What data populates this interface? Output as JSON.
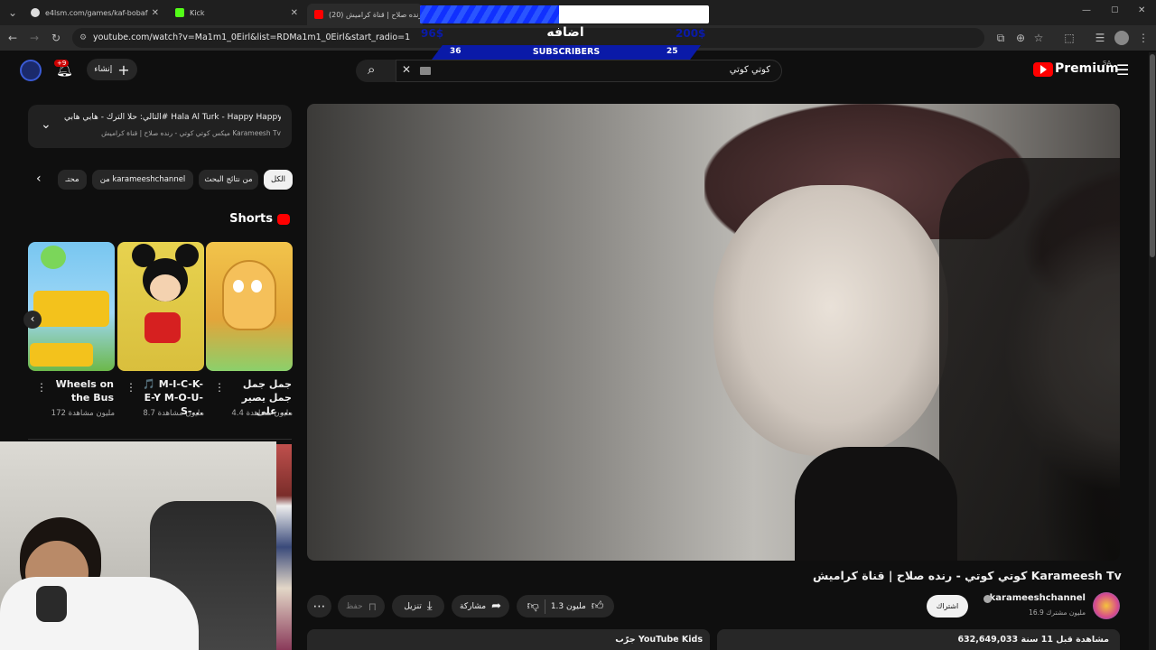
{
  "browser": {
    "tabs": [
      {
        "title": "e4lsm.com/games/kaf-bobaf",
        "active": false
      },
      {
        "title": "Kick",
        "active": false
      },
      {
        "title": "(20) كوتي كوتي - رنده صلاح | قناة كراميش",
        "active": true
      }
    ],
    "url": "youtube.com/watch?v=Ma1m1_0Eirl&list=RDMa1m1_0Eirl&start_radio=1"
  },
  "overlay": {
    "progress": 0.48,
    "title": "اضافه",
    "left_value": "96$",
    "right_value": "200$",
    "left_count": "36",
    "label": "SUBSCRIBERS",
    "right_count": "25"
  },
  "header": {
    "create_label": "إنشاء",
    "notif_badge": "+9",
    "search_text": "كوتي كوتي",
    "logo_text": "Premium",
    "region": "SA"
  },
  "upnext": {
    "title": "التالي: حلا الترك - هابي هابي# Hala Al Turk - Happy Happy",
    "subtitle": "ميكس كوتي كوتي - رنده صلاح | قناة كراميش Karameesh Tv"
  },
  "chips": [
    "الكل",
    "من نتائج البحث",
    "من karameeshchannel",
    "محتـ"
  ],
  "shorts": {
    "heading": "Shorts",
    "items": [
      {
        "title": "جمل جمل جمل يصير على ...",
        "views": "4.4 مليون مشاهدة"
      },
      {
        "title": "🎵 M-I-C-K-E-Y M-O-U-S-...",
        "views": "8.7 مليون مشاهدة"
      },
      {
        "title": "Wheels on the Bus",
        "views": "172 مليون مشاهدة"
      }
    ]
  },
  "video": {
    "title": "كوتي كوتي - رنده صلاح | قناة كراميش Karameesh Tv",
    "channel": "karameeshchannel",
    "subscribers": "16.9 مليون مشترك",
    "subscribe_label": "اشتراك",
    "likes": "1.3 مليون",
    "share_label": "مشاركة",
    "download_label": "تنزيل",
    "save_label": "حفظ",
    "views": "632,649,033 مشاهدة قبل 11 سنة",
    "tag": "جرّب YouTube Kids"
  },
  "colors": {
    "accent": "#ff0000",
    "overlay_blue": "#1030ff",
    "bg": "#0f0f0f"
  }
}
